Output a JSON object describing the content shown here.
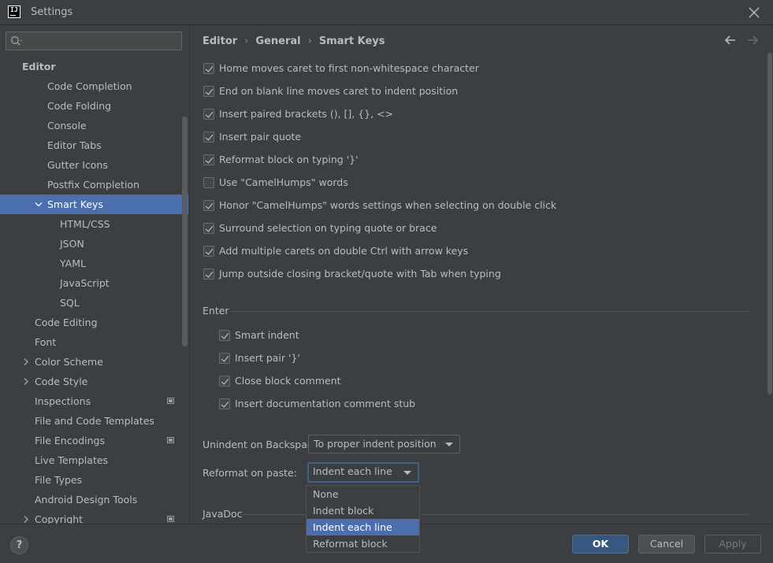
{
  "window": {
    "title": "Settings",
    "logo_text": "IJ"
  },
  "search": {
    "placeholder": "",
    "value": ""
  },
  "sidebar": {
    "items": [
      {
        "label": "Editor",
        "level": 0,
        "expanded": true
      },
      {
        "label": "Code Completion",
        "level": 2
      },
      {
        "label": "Code Folding",
        "level": 2
      },
      {
        "label": "Console",
        "level": 2
      },
      {
        "label": "Editor Tabs",
        "level": 2
      },
      {
        "label": "Gutter Icons",
        "level": 2
      },
      {
        "label": "Postfix Completion",
        "level": 2
      },
      {
        "label": "Smart Keys",
        "level": 2,
        "expanded": true,
        "selected": true
      },
      {
        "label": "HTML/CSS",
        "level": 3
      },
      {
        "label": "JSON",
        "level": 3
      },
      {
        "label": "YAML",
        "level": 3
      },
      {
        "label": "JavaScript",
        "level": 3
      },
      {
        "label": "SQL",
        "level": 3
      },
      {
        "label": "Code Editing",
        "level": 1
      },
      {
        "label": "Font",
        "level": 1
      },
      {
        "label": "Color Scheme",
        "level": 1,
        "collapsed": true
      },
      {
        "label": "Code Style",
        "level": 1,
        "collapsed": true
      },
      {
        "label": "Inspections",
        "level": 1,
        "project_icon": true
      },
      {
        "label": "File and Code Templates",
        "level": 1
      },
      {
        "label": "File Encodings",
        "level": 1,
        "project_icon": true
      },
      {
        "label": "Live Templates",
        "level": 1
      },
      {
        "label": "File Types",
        "level": 1
      },
      {
        "label": "Android Design Tools",
        "level": 1
      },
      {
        "label": "Copyright",
        "level": 1,
        "collapsed": true,
        "project_icon": true
      }
    ]
  },
  "breadcrumb": {
    "part1": "Editor",
    "part2": "General",
    "part3": "Smart Keys",
    "separator": "›"
  },
  "options": [
    {
      "label": "Home moves caret to first non-whitespace character",
      "checked": true
    },
    {
      "label": "End on blank line moves caret to indent position",
      "checked": true
    },
    {
      "label": "Insert paired brackets (), [], {}, <>",
      "checked": true
    },
    {
      "label": "Insert pair quote",
      "checked": true
    },
    {
      "label": "Reformat block on typing '}'",
      "checked": true
    },
    {
      "label": "Use \"CamelHumps\" words",
      "checked": false
    },
    {
      "label": "Honor \"CamelHumps\" words settings when selecting on double click",
      "checked": true
    },
    {
      "label": "Surround selection on typing quote or brace",
      "checked": true
    },
    {
      "label": "Add multiple carets on double Ctrl with arrow keys",
      "checked": true
    },
    {
      "label": "Jump outside closing bracket/quote with Tab when typing",
      "checked": true
    }
  ],
  "enter_section": {
    "title": "Enter",
    "options": [
      {
        "label": "Smart indent",
        "checked": true
      },
      {
        "label": "Insert pair '}'",
        "checked": true
      },
      {
        "label": "Close block comment",
        "checked": true
      },
      {
        "label": "Insert documentation comment stub",
        "checked": true
      }
    ]
  },
  "unindent": {
    "label": "Unindent on Backspace:",
    "value": "To proper indent position"
  },
  "reformat": {
    "label": "Reformat on paste:",
    "value": "Indent each line",
    "options": [
      "None",
      "Indent block",
      "Indent each line",
      "Reformat block"
    ],
    "selected_index": 2
  },
  "javadoc_section": {
    "title": "JavaDoc"
  },
  "footer": {
    "help": "?",
    "ok": "OK",
    "cancel": "Cancel",
    "apply": "Apply"
  },
  "colors": {
    "accent": "#4b6eaf",
    "background": "#3c3f41",
    "text": "#bbbbbb",
    "ok_button": "#365880"
  }
}
